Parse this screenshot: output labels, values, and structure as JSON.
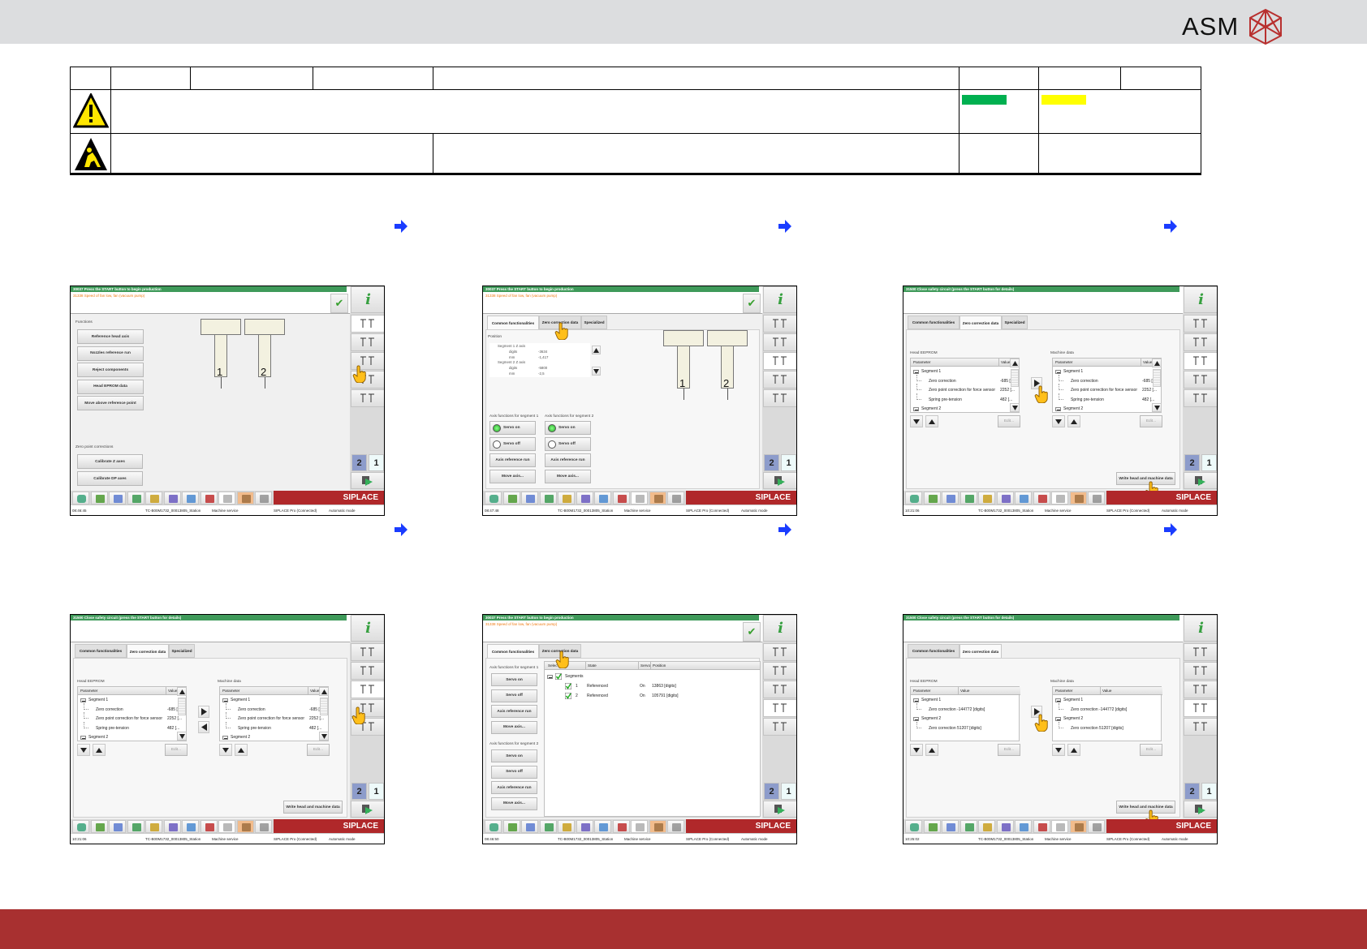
{
  "header": {
    "logo_text": "ASM"
  },
  "colors": {
    "brand_red": "#a83030",
    "green_swatch": "#00b050",
    "yellow_swatch": "#ffff00",
    "header_gray": "#dcdddf",
    "siplace_red": "#b0282a",
    "status_green": "#3f9a5a"
  },
  "common": {
    "brand": "SIPLACE",
    "station": "TC-B00M1732_00013805_Station",
    "user_mode": "Machine service",
    "connection": "SIPLACE Pro (Connected)",
    "op_mode": "Automatic mode",
    "info_label": "i",
    "check_label": "✔",
    "sidebar_num_2": "2",
    "sidebar_num_1": "1",
    "tabs": [
      "Common functionalities",
      "Zero correction data",
      "Specialized"
    ],
    "head_numbers": [
      "1",
      "2"
    ],
    "toolbar_icons": [
      "machine-icon",
      "grid-icon",
      "chart-icon",
      "board-icon",
      "feeder-icon",
      "graph-icon",
      "camera-icon",
      "tool-icon",
      "service-icon",
      "maintenance-icon",
      "wrench-icon"
    ],
    "eeprom_label": "Head EEPROM",
    "machine_label": "Machine data",
    "col_parameter": "Parameter",
    "col_value": "Value",
    "edit_label": "Edit...",
    "write_label": "Write head and machine data",
    "axis_seg1": "Axis functions for segment 1",
    "axis_seg2": "Axis functions for segment 2",
    "axis_buttons": [
      "Servo on",
      "Servo off",
      "Axis reference run",
      "Move axis..."
    ],
    "zero_rows": [
      {
        "text": "Segment 1",
        "value": "",
        "level": 0
      },
      {
        "text": "Zero correction",
        "value": "-685 [...",
        "level": 1
      },
      {
        "text": "Zero point correction for force sensor",
        "value": "2252 [...",
        "level": 1
      },
      {
        "text": "Spring pre-tension",
        "value": "482 [...",
        "level": 1
      },
      {
        "text": "Segment 2",
        "value": "",
        "level": 0
      }
    ]
  },
  "panels": [
    {
      "msg_green": "30037 Press the START button to begin production",
      "msg_orange": "31338 Speed of fan low, fan (vacuum pump)",
      "time": "08:46:45",
      "view": "functions",
      "active_side": 0,
      "functions_label": "Functions",
      "functions": [
        "Reference head axis",
        "Nozzles reference run",
        "Reject components",
        "Head EPROM data",
        "Move above reference point"
      ],
      "zero_label": "Zero point corrections",
      "zero_buttons": [
        "Calibrate Z axes",
        "Calibrate DP axes"
      ]
    },
    {
      "msg_green": "30037 Press the START button to begin production",
      "msg_orange": "31338 Speed of fan low, fan (vacuum pump)",
      "time": "08:47:48",
      "view": "common",
      "active_side": 2,
      "position_label": "Position",
      "tree": [
        {
          "text": "Segment 1 Z axis",
          "value": "",
          "level": 0
        },
        {
          "text": "digits",
          "value": "-3634",
          "level": 1
        },
        {
          "text": "mm",
          "value": "-1,417",
          "level": 1
        },
        {
          "text": "Segment 2 Z axis",
          "value": "",
          "level": 0
        },
        {
          "text": "digits",
          "value": "-5800",
          "level": 1
        },
        {
          "text": "mm",
          "value": "-2,5",
          "level": 1
        }
      ]
    },
    {
      "msg_green": "31500 Close safety circuit (press the START button for details)",
      "time": "10:21:06",
      "view": "zero",
      "active_side": 2
    },
    {
      "msg_green": "31500 Close safety circuit (press the START button for details)",
      "time": "10:21:06",
      "view": "zero",
      "active_side": 2,
      "show_left_arrow": true
    },
    {
      "msg_green": "30037 Press the START button to begin production",
      "msg_orange": "31338 Speed of fan low, fan (vacuum pump)",
      "time": "08:46:50",
      "view": "segments",
      "active_side": 3,
      "seg_headers": [
        "Selec",
        "State",
        "Servo",
        "Position"
      ],
      "seg_root": "Segments",
      "seg_rows": [
        {
          "num": "1",
          "state": "Referenced",
          "servo": "On",
          "position": "13863 [digits]"
        },
        {
          "num": "2",
          "state": "Referenced",
          "servo": "On",
          "position": "105791 [digits]"
        }
      ]
    },
    {
      "msg_green": "31500 Close safety circuit (press the START button for details)",
      "time": "10:25:02",
      "view": "zero2",
      "active_side": 3,
      "zero2_rows": [
        {
          "text": "Segment 1",
          "level": 0
        },
        {
          "text": "Zero correction -144772 [digits]",
          "level": 1
        },
        {
          "text": "Segment 2",
          "level": 0
        },
        {
          "text": "Zero correction 51207 [digits]",
          "level": 1
        }
      ],
      "zero2_rows_machine": [
        {
          "text": "Segment 1",
          "level": 0
        },
        {
          "text": "Zero correction -144772 [digits]",
          "level": 1
        },
        {
          "text": "Segment 2",
          "level": 0
        },
        {
          "text": "Zero correction 51207 [digits]",
          "level": 1
        }
      ]
    }
  ]
}
